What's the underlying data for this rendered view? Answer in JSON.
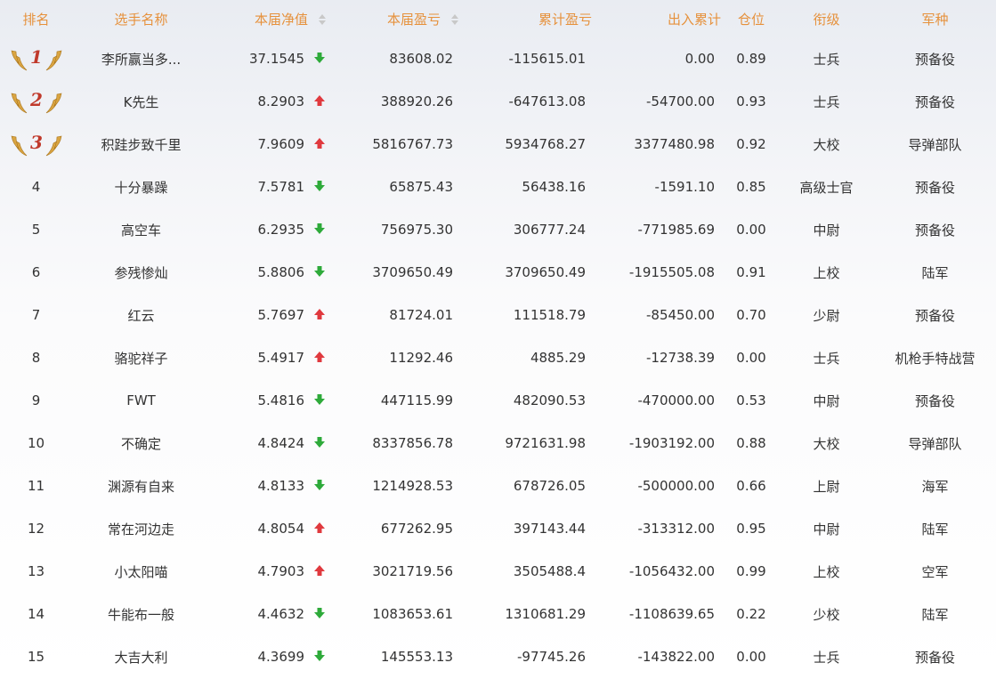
{
  "headers": {
    "rank": "排名",
    "name": "选手名称",
    "nav": "本届净值",
    "pnl": "本届盈亏",
    "cum_pnl": "累计盈亏",
    "flow": "出入累计",
    "position": "仓位",
    "title": "衔级",
    "branch": "军种"
  },
  "colors": {
    "header": "#e6913c",
    "up": "#e0393e",
    "down": "#2eaa3a",
    "medal": "#c0392b"
  },
  "rows": [
    {
      "rank": "1",
      "medal": true,
      "name": "李所赢当多...",
      "nav": "37.1545",
      "trend": "down",
      "pnl": "83608.02",
      "cum_pnl": "-115615.01",
      "flow": "0.00",
      "position": "0.89",
      "title": "士兵",
      "branch": "预备役"
    },
    {
      "rank": "2",
      "medal": true,
      "name": "K先生",
      "nav": "8.2903",
      "trend": "up",
      "pnl": "388920.26",
      "cum_pnl": "-647613.08",
      "flow": "-54700.00",
      "position": "0.93",
      "title": "士兵",
      "branch": "预备役"
    },
    {
      "rank": "3",
      "medal": true,
      "name": "积跬步致千里",
      "nav": "7.9609",
      "trend": "up",
      "pnl": "5816767.73",
      "cum_pnl": "5934768.27",
      "flow": "3377480.98",
      "position": "0.92",
      "title": "大校",
      "branch": "导弹部队"
    },
    {
      "rank": "4",
      "medal": false,
      "name": "十分暴躁",
      "nav": "7.5781",
      "trend": "down",
      "pnl": "65875.43",
      "cum_pnl": "56438.16",
      "flow": "-1591.10",
      "position": "0.85",
      "title": "高级士官",
      "branch": "预备役"
    },
    {
      "rank": "5",
      "medal": false,
      "name": "高空车",
      "nav": "6.2935",
      "trend": "down",
      "pnl": "756975.30",
      "cum_pnl": "306777.24",
      "flow": "-771985.69",
      "position": "0.00",
      "title": "中尉",
      "branch": "预备役"
    },
    {
      "rank": "6",
      "medal": false,
      "name": "参残惨灿",
      "nav": "5.8806",
      "trend": "down",
      "pnl": "3709650.49",
      "cum_pnl": "3709650.49",
      "flow": "-1915505.08",
      "position": "0.91",
      "title": "上校",
      "branch": "陆军"
    },
    {
      "rank": "7",
      "medal": false,
      "name": "红云",
      "nav": "5.7697",
      "trend": "up",
      "pnl": "81724.01",
      "cum_pnl": "111518.79",
      "flow": "-85450.00",
      "position": "0.70",
      "title": "少尉",
      "branch": "预备役"
    },
    {
      "rank": "8",
      "medal": false,
      "name": "骆驼祥子",
      "nav": "5.4917",
      "trend": "up",
      "pnl": "11292.46",
      "cum_pnl": "4885.29",
      "flow": "-12738.39",
      "position": "0.00",
      "title": "士兵",
      "branch": "机枪手特战营"
    },
    {
      "rank": "9",
      "medal": false,
      "name": "FWT",
      "nav": "5.4816",
      "trend": "down",
      "pnl": "447115.99",
      "cum_pnl": "482090.53",
      "flow": "-470000.00",
      "position": "0.53",
      "title": "中尉",
      "branch": "预备役"
    },
    {
      "rank": "10",
      "medal": false,
      "name": "不确定",
      "nav": "4.8424",
      "trend": "down",
      "pnl": "8337856.78",
      "cum_pnl": "9721631.98",
      "flow": "-1903192.00",
      "position": "0.88",
      "title": "大校",
      "branch": "导弹部队"
    },
    {
      "rank": "11",
      "medal": false,
      "name": "渊源有自来",
      "nav": "4.8133",
      "trend": "down",
      "pnl": "1214928.53",
      "cum_pnl": "678726.05",
      "flow": "-500000.00",
      "position": "0.66",
      "title": "上尉",
      "branch": "海军"
    },
    {
      "rank": "12",
      "medal": false,
      "name": "常在河边走",
      "nav": "4.8054",
      "trend": "up",
      "pnl": "677262.95",
      "cum_pnl": "397143.44",
      "flow": "-313312.00",
      "position": "0.95",
      "title": "中尉",
      "branch": "陆军"
    },
    {
      "rank": "13",
      "medal": false,
      "name": "小太阳喵",
      "nav": "4.7903",
      "trend": "up",
      "pnl": "3021719.56",
      "cum_pnl": "3505488.4",
      "flow": "-1056432.00",
      "position": "0.99",
      "title": "上校",
      "branch": "空军"
    },
    {
      "rank": "14",
      "medal": false,
      "name": "牛能布一般",
      "nav": "4.4632",
      "trend": "down",
      "pnl": "1083653.61",
      "cum_pnl": "1310681.29",
      "flow": "-1108639.65",
      "position": "0.22",
      "title": "少校",
      "branch": "陆军"
    },
    {
      "rank": "15",
      "medal": false,
      "name": "大吉大利",
      "nav": "4.3699",
      "trend": "down",
      "pnl": "145553.13",
      "cum_pnl": "-97745.26",
      "flow": "-143822.00",
      "position": "0.00",
      "title": "士兵",
      "branch": "预备役"
    }
  ]
}
